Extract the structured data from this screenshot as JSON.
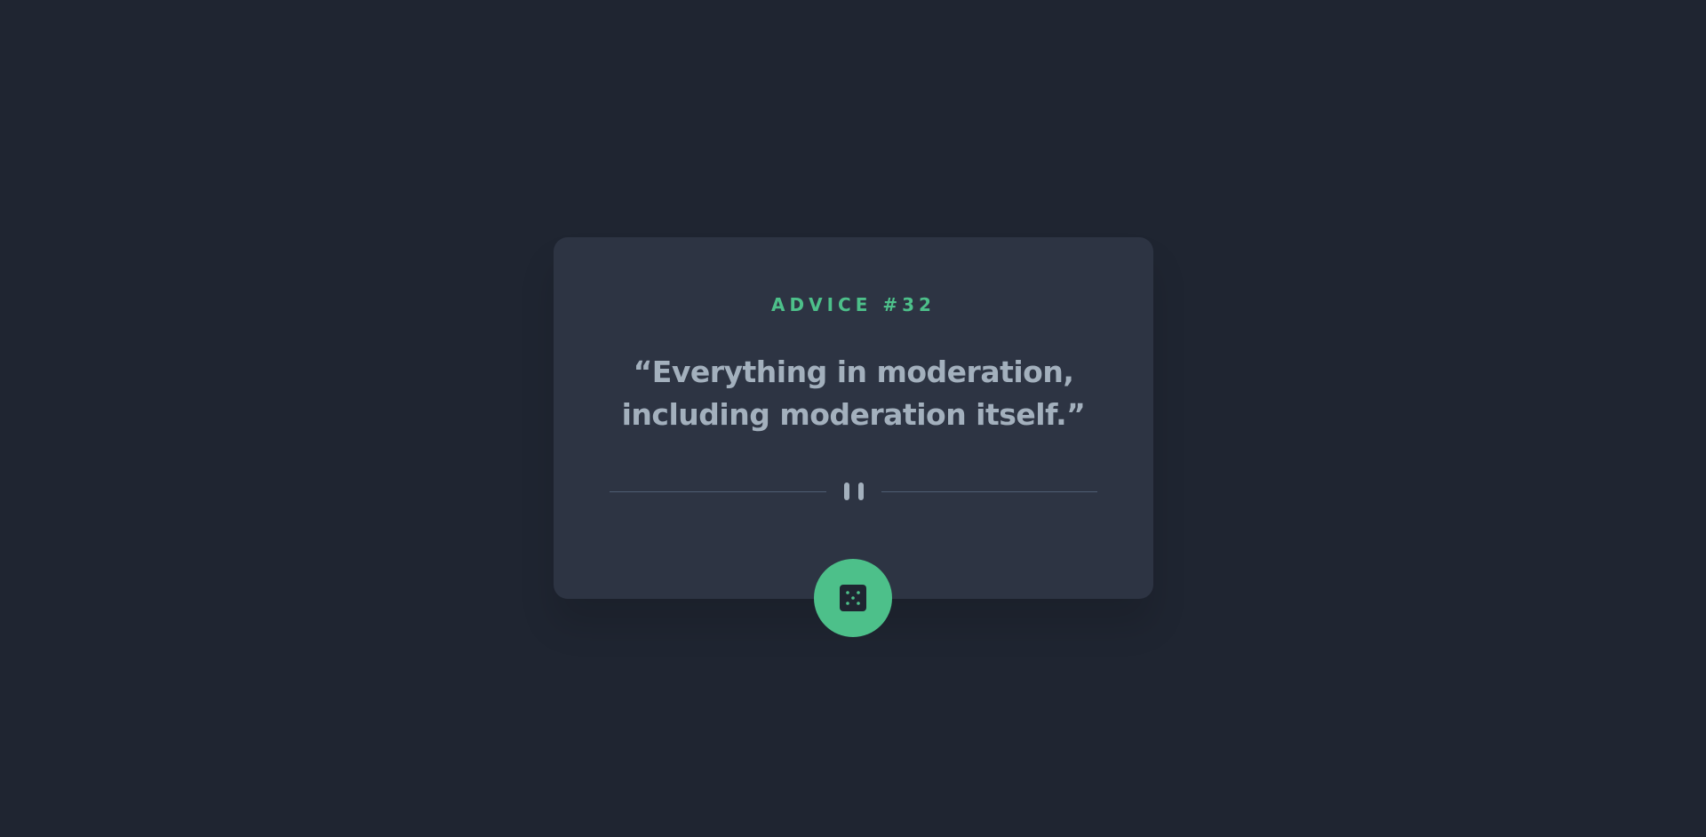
{
  "advice": {
    "id_label": "ADVICE #32",
    "quote": "“Everything in moderation, including moderation itself.”"
  },
  "divider": {
    "icon": "pause-icon"
  },
  "dice_button": {
    "icon": "dice-icon",
    "color": "#4dc08a"
  },
  "colors": {
    "background": "#1f2531",
    "card": "#2d3443",
    "accent": "#4dc08a",
    "text": "#a3b0bd"
  }
}
